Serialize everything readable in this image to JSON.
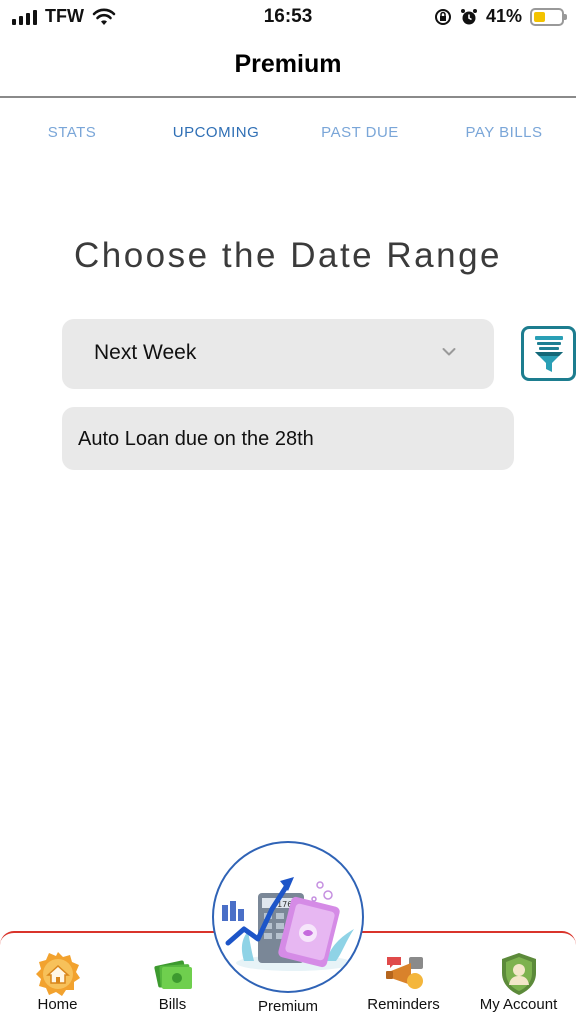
{
  "status_bar": {
    "carrier": "TFW",
    "time": "16:53",
    "battery": "41%",
    "battery_level": 0.41
  },
  "header": {
    "title": "Premium"
  },
  "tabs": [
    {
      "label": "STATS",
      "active": false
    },
    {
      "label": "UPCOMING",
      "active": true
    },
    {
      "label": "PAST DUE",
      "active": false
    },
    {
      "label": "PAY BILLS",
      "active": false
    }
  ],
  "main": {
    "title": "Choose the Date Range",
    "date_range": {
      "selected": "Next Week"
    },
    "filter_icon": "funnel-icon",
    "items": [
      {
        "text": "Auto Loan due on the 28th"
      }
    ]
  },
  "bottom_nav": {
    "items": [
      {
        "label": "Home",
        "icon": "home-icon"
      },
      {
        "label": "Bills",
        "icon": "bills-icon"
      },
      {
        "label": "Premium",
        "icon": "premium-icon"
      },
      {
        "label": "Reminders",
        "icon": "reminders-icon"
      },
      {
        "label": "My Account",
        "icon": "account-icon"
      }
    ]
  },
  "colors": {
    "tab_active": "#2f6fb5",
    "tab_inactive": "#7aa6d8",
    "accent_teal": "#1d7d8f",
    "nav_border": "#d9342b",
    "premium_ring": "#2f63b6",
    "battery_fill": "#f3c300"
  }
}
